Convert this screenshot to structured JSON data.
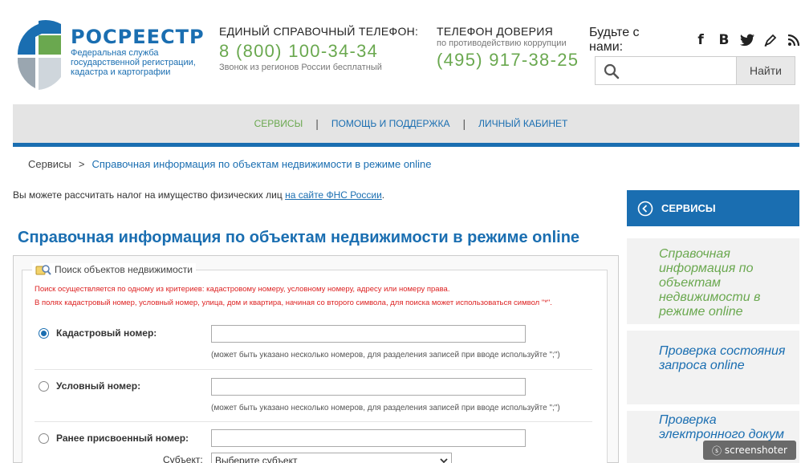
{
  "header": {
    "brand_name": "РОСРЕЕСТР",
    "brand_sub_1": "Федеральная служба",
    "brand_sub_2": "государственной регистрации,",
    "brand_sub_3": "кадастра и картографии",
    "phone_title": "ЕДИНЫЙ СПРАВОЧНЫЙ ТЕЛЕФОН:",
    "phone_number": "8 (800) 100-34-34",
    "phone_note": "Звонок из регионов России бесплатный",
    "trust_title": "ТЕЛЕФОН ДОВЕРИЯ",
    "trust_sub": "по противодействию коррупции",
    "trust_number": "(495) 917-38-25",
    "social_label": "Будьте с нами:",
    "social_icons": [
      "facebook-icon",
      "vk-icon",
      "twitter-icon",
      "blog-icon",
      "rss-icon"
    ],
    "search": {
      "placeholder": "",
      "value": "",
      "button": "Найти"
    }
  },
  "nav": {
    "items": [
      {
        "label": "СЕРВИСЫ",
        "active": true
      },
      {
        "label": "ПОМОЩЬ И ПОДДЕРЖКА",
        "active": false
      },
      {
        "label": "ЛИЧНЫЙ КАБИНЕТ",
        "active": false
      }
    ],
    "separator": "|"
  },
  "breadcrumb": {
    "root": "Сервисы",
    "separator": ">",
    "current": "Справочная информация по объектам недвижимости в режиме online"
  },
  "tax_note": {
    "text": "Вы можете рассчитать налог на имущество физических лиц",
    "link": "на сайте ФНС России",
    "end": "."
  },
  "page_title": "Справочная информация по объектам недвижимости в режиме online",
  "form": {
    "legend": "Поиск объектов недвижимости",
    "warning_1": "Поиск осуществляется по одному из критериев: кадастровому номеру, условному номеру, адресу или номеру права.",
    "warning_2": "В полях кадастровый номер, условный номер, улица, дом и квартира, начиная со второго символа, для поиска может использоваться символ \"*\".",
    "cadastral_label": "Кадастровый номер:",
    "cadastral_value": "",
    "cadastral_hint": "(может быть указано несколько номеров, для разделения записей при вводе используйте \";\")",
    "conditional_label": "Условный номер:",
    "conditional_value": "",
    "conditional_hint": "(может быть указано несколько номеров, для разделения записей при вводе используйте \";\")",
    "previous_label": "Ранее присвоенный номер:",
    "previous_value": "",
    "subject_label": "Субъект:",
    "subject_selected": "Выберите субъект"
  },
  "sidebar": {
    "title": "СЕРВИСЫ",
    "items": [
      {
        "label": "Справочная информация по объектам недвижимости в режиме online",
        "active": true
      },
      {
        "label": "Проверка состояния запроса online",
        "active": false
      },
      {
        "label": "Проверка электронного докум",
        "active": false
      }
    ]
  },
  "watermark": "screenshoter",
  "colors": {
    "brand_blue": "#1a6eb1",
    "accent_green": "#6aa84f",
    "warning_red": "#dd2222"
  }
}
